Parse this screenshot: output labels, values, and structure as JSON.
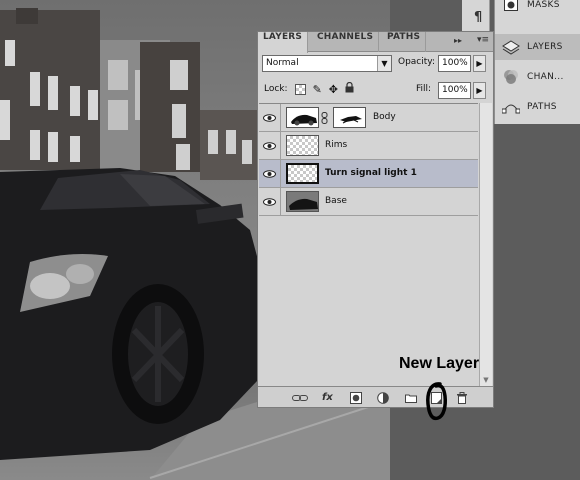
{
  "layers_panel": {
    "tabs": [
      {
        "label": "LAYERS",
        "active": true
      },
      {
        "label": "CHANNELS",
        "active": false
      },
      {
        "label": "PATHS",
        "active": false
      }
    ],
    "tab_collapse_glyph": "▸▸",
    "tab_menu_glyph": "▾≡",
    "blend_mode": "Normal",
    "opacity_label": "Opacity:",
    "opacity_value": "100%",
    "lock_label": "Lock:",
    "fill_label": "Fill:",
    "fill_value": "100%",
    "layers": [
      {
        "name": "Body",
        "visible": true,
        "selected": false,
        "has_mask": true
      },
      {
        "name": "Rims",
        "visible": true,
        "selected": false,
        "has_mask": false
      },
      {
        "name": "Turn signal light 1",
        "visible": true,
        "selected": true,
        "has_mask": false
      },
      {
        "name": "Base",
        "visible": true,
        "selected": false,
        "has_mask": false
      }
    ],
    "bottom_icons": [
      "link-layers-icon",
      "fx-icon",
      "add-mask-icon",
      "adjustment-layer-icon",
      "new-group-icon",
      "new-layer-icon",
      "trash-icon"
    ],
    "fx_label": "fx"
  },
  "dock": {
    "strip_glyph": "¶",
    "items": [
      {
        "label": "MASKS",
        "active": false,
        "icon": "masks-icon"
      },
      {
        "label": "LAYERS",
        "active": true,
        "icon": "layers-icon"
      },
      {
        "label": "CHAN...",
        "active": false,
        "icon": "channels-icon"
      },
      {
        "label": "PATHS",
        "active": false,
        "icon": "paths-icon"
      }
    ]
  },
  "annotation": {
    "text": "New Layer"
  },
  "colors": {
    "selected_row": "#b8bccb",
    "panel_bg": "#d4d4d4",
    "workspace_bg": "#5c5c5c"
  }
}
